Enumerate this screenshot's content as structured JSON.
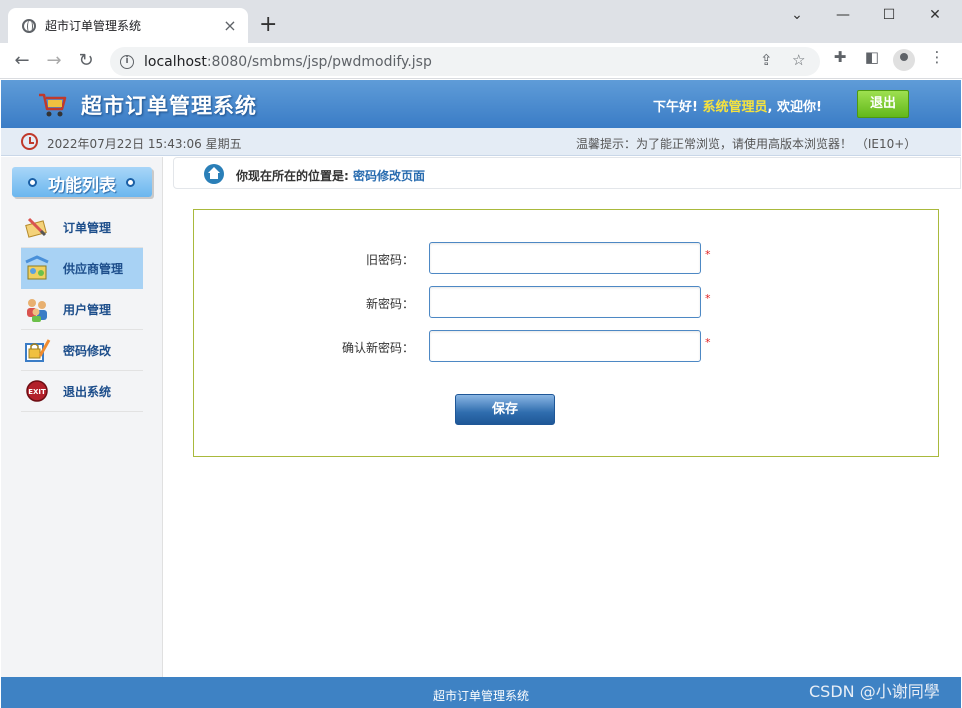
{
  "browser": {
    "tab_title": "超市订单管理系统",
    "tab_close": "×",
    "new_tab": "+",
    "url_host": "localhost",
    "url_rest": ":8080/smbms/jsp/pwdmodify.jsp",
    "window_controls": [
      "⌄",
      "—",
      "☐",
      "✕"
    ]
  },
  "header": {
    "title": "超市订单管理系统",
    "greeting": "下午好!",
    "username": "系统管理员",
    "welcome": ", 欢迎你!",
    "logout_label": "退出"
  },
  "timebar": {
    "datetime": "2022年07月22日 15:43:06 星期五",
    "tip": "温馨提示：为了能正常浏览，请使用高版本浏览器！ （IE10+）"
  },
  "sidebar": {
    "title": "功能列表",
    "items": [
      {
        "label": "订单管理",
        "icon": "order-icon",
        "active": false
      },
      {
        "label": "供应商管理",
        "icon": "provider-icon",
        "active": true
      },
      {
        "label": "用户管理",
        "icon": "users-icon",
        "active": false
      },
      {
        "label": "密码修改",
        "icon": "password-icon",
        "active": false
      },
      {
        "label": "退出系统",
        "icon": "exit-icon",
        "active": false
      }
    ]
  },
  "breadcrumb": {
    "prefix": "你现在所在的位置是: ",
    "current": "密码修改页面"
  },
  "form": {
    "old_password_label": "旧密码：",
    "old_password_value": "",
    "new_password_label": "新密码：",
    "new_password_value": "",
    "confirm_password_label": "确认新密码：",
    "confirm_password_value": "",
    "required_mark": "*",
    "save_label": "保存"
  },
  "footer": {
    "text": "超市订单管理系统",
    "watermark": "CSDN @小谢同學"
  },
  "colors": {
    "header_blue": "#3a7cc6",
    "logout_green": "#62b81a",
    "username_yellow": "#f6e33e",
    "form_border": "#a9b93c",
    "required_red": "#e02020"
  }
}
